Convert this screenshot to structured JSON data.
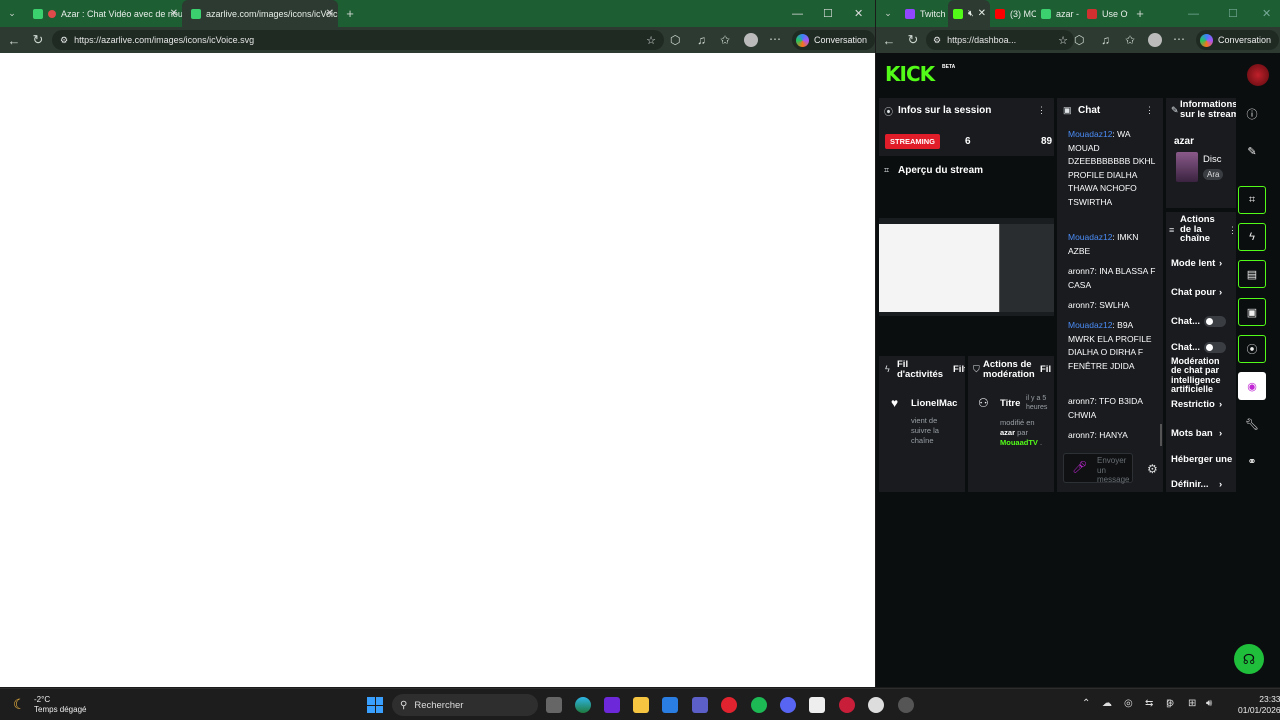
{
  "left_window": {
    "tabs": [
      {
        "title": "Azar : Chat Vidéo avec de nou",
        "active": false
      },
      {
        "title": "azarlive.com/images/icons/icVoic",
        "active": true
      }
    ],
    "url": "https://azarlive.com/images/icons/icVoice.svg",
    "conversation_label": "Conversation"
  },
  "right_window": {
    "tabs": [
      "Twitch",
      "(3) MC",
      "azar -",
      "Use Of"
    ],
    "url": "https://dashboa...",
    "conversation_label": "Conversation"
  },
  "kick": {
    "logo": "KICK",
    "beta": "BETA",
    "session": {
      "title": "Infos sur la session",
      "status_badge": "STREAMING",
      "stat1": "6",
      "stat2": "89",
      "preview_title": "Aperçu du stream"
    },
    "chat": {
      "title": "Chat",
      "messages": [
        {
          "user": "Mouadaz12",
          "text": ": WA MOUAD DZEEBBBBBBB DKHL PROFILE DIALHA THAWA NCHOFO TSWIRTHA",
          "blue": true
        },
        {
          "user": "Mouadaz12",
          "text": ": IMKN AZBE",
          "blue": true
        },
        {
          "user": "aronn7",
          "text": ": INA BLASSA F CASA",
          "blue": false
        },
        {
          "user": "aronn7",
          "text": ": SWLHA",
          "blue": false
        },
        {
          "user": "Mouadaz12",
          "text": ": B9A MWRK ELA PROFILE DIALHA O DIRHA F FENÊTRE JDIDA",
          "blue": true
        },
        {
          "user": "aronn7",
          "text": ": TFO B3IDA CHWIA",
          "blue": false
        },
        {
          "user": "aronn7",
          "text": ": HANYA",
          "blue": false
        }
      ],
      "input_placeholder": "Envoyer un message"
    },
    "info": {
      "title": "Informations sur le stream",
      "channel": "azar",
      "category": "Disc",
      "tag": "Ara"
    },
    "actions": {
      "title": "Actions de la chaîne",
      "items": [
        "Mode lent",
        "Chat pour",
        "Chat...",
        "Chat...",
        "Modération de chat par intelligence artificielle",
        "Restrictio",
        "Mots ban",
        "Héberger une",
        "Définir..."
      ]
    },
    "activity": {
      "title": "Fil d'activités",
      "filter": "Filt",
      "user": "LionelMac",
      "text": "vient de suivre la chaîne"
    },
    "moderation": {
      "title": "Actions de modération",
      "filter": "Fil",
      "item_title": "Titre",
      "time": "il y a 5 heures",
      "text_prefix": "modifié en",
      "channel": "azar",
      "by": "par",
      "moderator": "MouaadTV",
      "dot": "."
    }
  },
  "taskbar": {
    "temp": "-2°C",
    "weather": "Temps dégagé",
    "search": "Rechercher",
    "time": "23:33",
    "date": "01/01/2026"
  }
}
